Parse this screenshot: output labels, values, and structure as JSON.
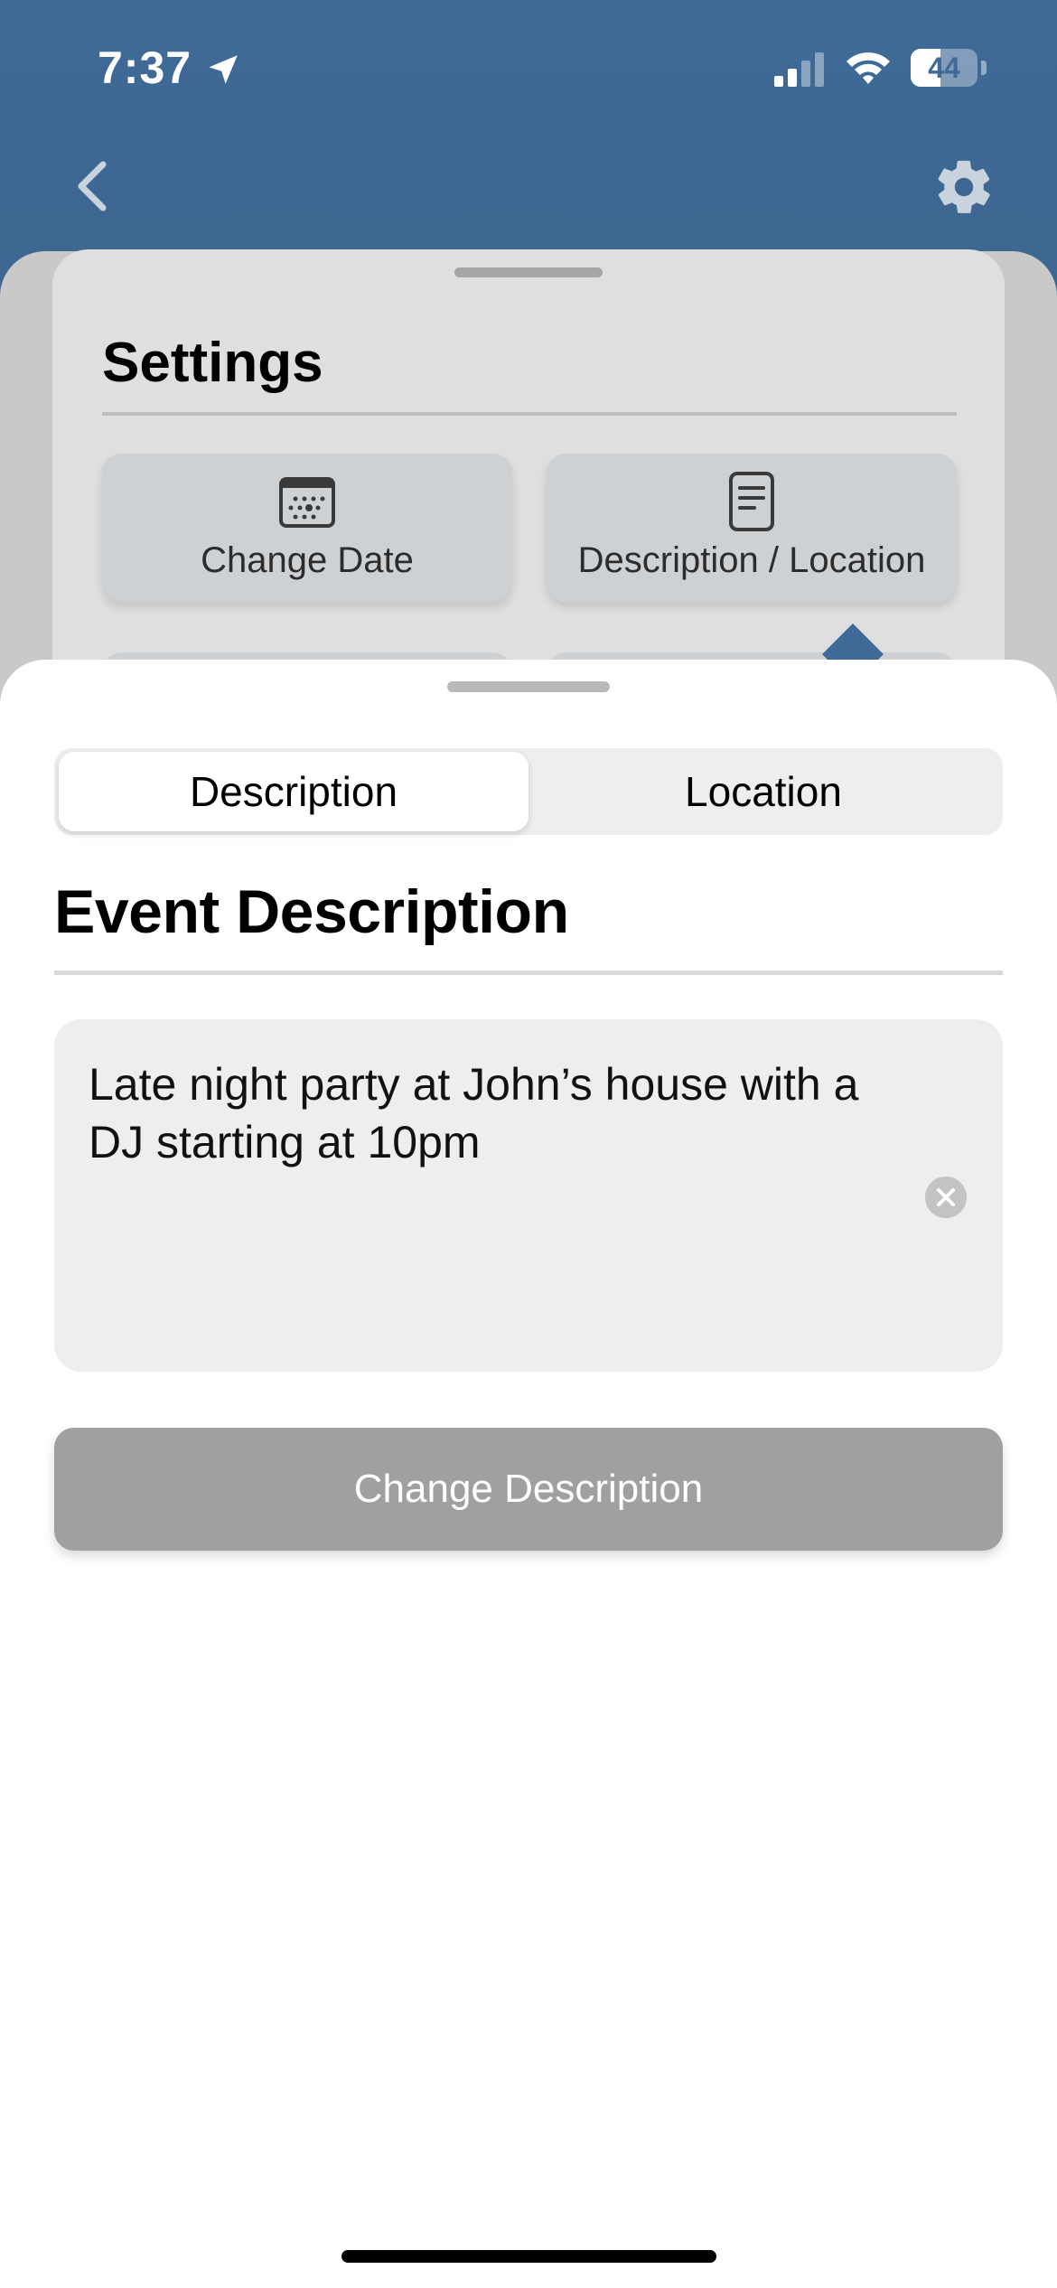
{
  "status_bar": {
    "time": "7:37",
    "battery_percent": "44",
    "battery_level": 0.44,
    "icons": [
      "location-arrow-icon",
      "cellular-signal-icon",
      "wifi-icon",
      "battery-icon"
    ]
  },
  "nav": {
    "back_icon": "chevron-left-icon",
    "settings_icon": "gear-icon"
  },
  "settings_panel": {
    "title": "Settings",
    "tiles": [
      {
        "label": "Change Date",
        "icon": "calendar-icon"
      },
      {
        "label": "Description / Location",
        "icon": "document-icon"
      }
    ]
  },
  "sheet": {
    "tabs": [
      {
        "label": "Description",
        "selected": true
      },
      {
        "label": "Location",
        "selected": false
      }
    ],
    "heading": "Event Description",
    "description_value": "Late night party at John’s house with a DJ starting at 10pm",
    "submit_label": "Change Description"
  },
  "colors": {
    "header_blue": "#3f6a97",
    "button_disabled": "#a0a0a0",
    "field_bg": "#eeeeee"
  }
}
